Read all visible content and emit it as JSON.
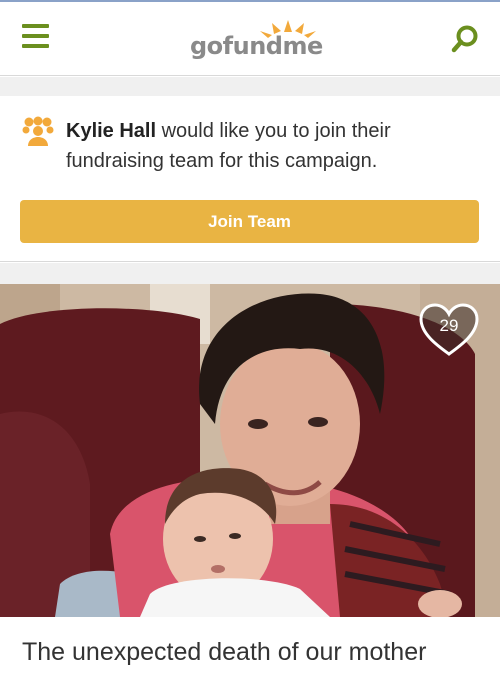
{
  "header": {
    "menu_icon": "hamburger-menu-icon",
    "logo": {
      "go": "go",
      "fund": "fund",
      "me": "me",
      "accent": "#f2a93b"
    },
    "search_icon": "search-icon",
    "accent": "#6b8f1f"
  },
  "invite": {
    "icon": "team-icon",
    "name": "Kylie Hall",
    "message": "would like you to join their fundraising team for this campaign.",
    "button_label": "Join Team",
    "button_color": "#e9b443"
  },
  "campaign": {
    "image": "photo-of-woman-holding-baby",
    "heart_icon": "heart-icon",
    "heart_count": "29",
    "title": "The unexpected death of our mother"
  }
}
